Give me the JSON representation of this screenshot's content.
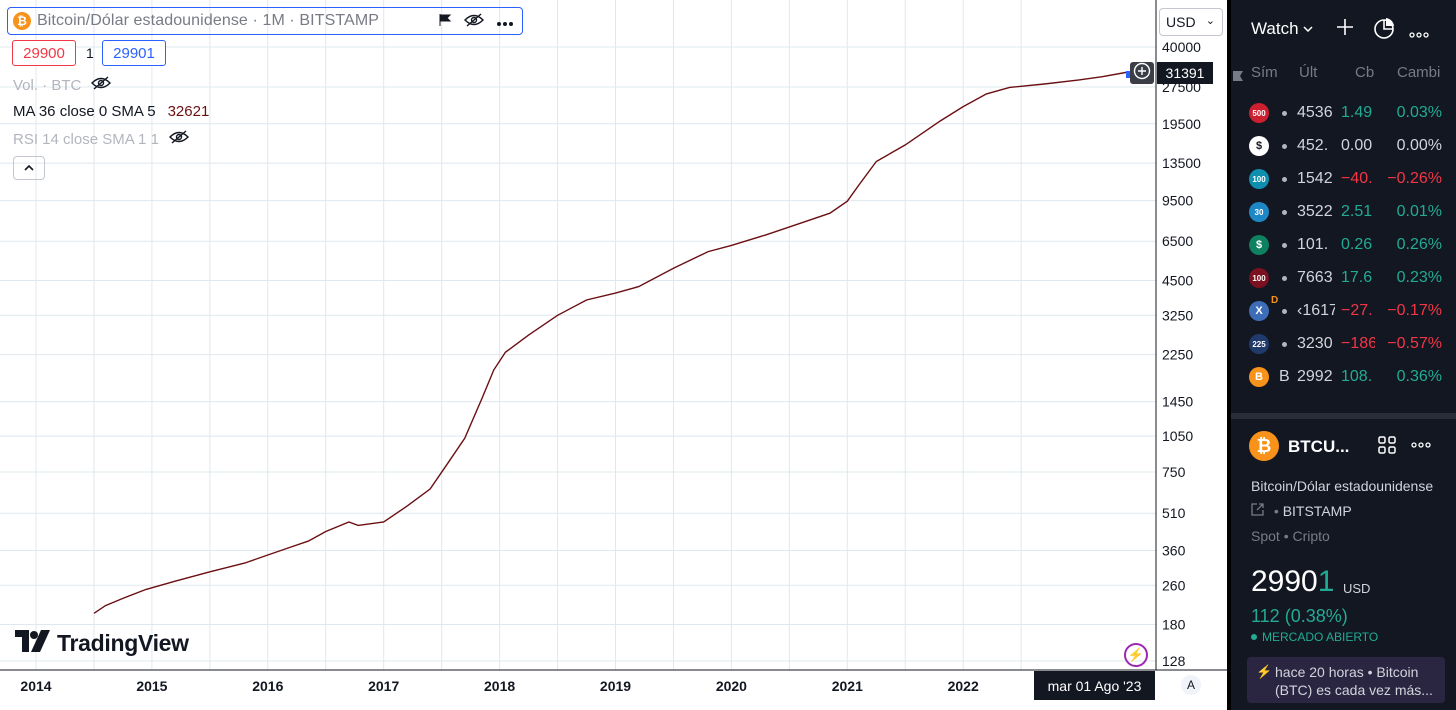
{
  "chart": {
    "legend_title": "Bitcoin/Dólar estadounidense · 1M · BITSTAMP",
    "bid": "29900",
    "spread": "1",
    "ask": "29901",
    "indicators": {
      "volume": "Vol. · BTC",
      "ma_label": "MA 36 close 0 SMA 5",
      "ma_value": "32621",
      "rsi": "RSI 14 close SMA 1 1"
    },
    "currency": "USD",
    "last_price": "31391",
    "crosshair_time": "mar 01 Ago '23",
    "auto_label": "A",
    "logo": "TradingView",
    "price_ticks": [
      "40000",
      "27500",
      "19500",
      "13500",
      "9500",
      "6500",
      "4500",
      "3250",
      "2250",
      "1450",
      "1050",
      "750",
      "510",
      "360",
      "260",
      "180",
      "128"
    ],
    "time_ticks": [
      "2014",
      "2015",
      "2016",
      "2017",
      "2018",
      "2019",
      "2020",
      "2021",
      "2022"
    ],
    "series_color": "#6b0f12",
    "chart_data": {
      "type": "line",
      "title": "",
      "xlabel": "",
      "ylabel": "",
      "log_scale": true,
      "ylim": [
        128,
        40000
      ],
      "xlim": [
        2014.0,
        2023.9
      ],
      "grid": true,
      "series": [
        {
          "name": "MA 36 close 0 SMA 5",
          "x": [
            2014.5,
            2014.6,
            2014.75,
            2014.95,
            2015.2,
            2015.5,
            2015.8,
            2016.0,
            2016.2,
            2016.35,
            2016.5,
            2016.7,
            2016.78,
            2016.85,
            2017.0,
            2017.2,
            2017.4,
            2017.55,
            2017.7,
            2017.85,
            2017.95,
            2018.05,
            2018.25,
            2018.5,
            2018.75,
            2019.0,
            2019.2,
            2019.5,
            2019.8,
            2020.0,
            2020.3,
            2020.6,
            2020.85,
            2021.0,
            2021.1,
            2021.25,
            2021.5,
            2021.8,
            2022.0,
            2022.2,
            2022.4,
            2022.7,
            2023.0,
            2023.2,
            2023.4,
            2023.6
          ],
          "values": [
            200,
            215,
            230,
            250,
            270,
            295,
            320,
            345,
            372,
            393,
            430,
            470,
            455,
            460,
            470,
            545,
            640,
            810,
            1030,
            1500,
            1950,
            2300,
            2700,
            3250,
            3750,
            4000,
            4250,
            5050,
            5900,
            6250,
            6900,
            7700,
            8450,
            9450,
            11000,
            13700,
            16000,
            20000,
            22900,
            25800,
            27400,
            28300,
            29400,
            30300,
            31500,
            32621
          ]
        }
      ]
    }
  },
  "watchlist": {
    "header_label": "Watch",
    "columns": [
      "Sím",
      "Últ",
      "Cb",
      "Cambi"
    ],
    "rows": [
      {
        "badge": "500",
        "badge_color": "#cc1f2f",
        "sym": "",
        "last": "4536",
        "chg": "1.49",
        "pct": "0.03%",
        "dir": "up"
      },
      {
        "badge": "$",
        "badge_color": "#ffffff",
        "sym": "",
        "last": "452.",
        "chg": "0.00",
        "pct": "0.00%",
        "dir": "flat"
      },
      {
        "badge": "100",
        "badge_color": "#0f8fb0",
        "sym": "",
        "last": "1542",
        "chg": "−40.",
        "pct": "−0.26%",
        "dir": "down"
      },
      {
        "badge": "30",
        "badge_color": "#1e88c6",
        "sym": "",
        "last": "3522",
        "chg": "2.51",
        "pct": "0.01%",
        "dir": "up"
      },
      {
        "badge": "$",
        "badge_color": "#0f8060",
        "sym": "",
        "last": "101.",
        "chg": "0.26",
        "pct": "0.26%",
        "dir": "up"
      },
      {
        "badge": "100",
        "badge_color": "#7a1020",
        "sym": "",
        "last": "7663",
        "chg": "17.6",
        "pct": "0.23%",
        "dir": "up"
      },
      {
        "badge": "X",
        "badge_color": "#3d6db8",
        "sym": "",
        "last": "‹1617",
        "chg": "−27.",
        "pct": "−0.17%",
        "dir": "down",
        "flag": "D"
      },
      {
        "badge": "225",
        "badge_color": "#1f3a6b",
        "sym": "",
        "last": "3230",
        "chg": "−186",
        "pct": "−0.57%",
        "dir": "down"
      },
      {
        "badge": "B",
        "badge_color": "#f7931a",
        "sym": "B",
        "last": "2992",
        "chg": "108.",
        "pct": "0.36%",
        "dir": "up"
      }
    ]
  },
  "detail": {
    "symbol": "BTCU...",
    "description": "Bitcoin/Dólar estadounidense",
    "exchange": "BITSTAMP",
    "type": "Spot • Cripto",
    "price_main": "2990",
    "price_tail": "1",
    "price_currency": "USD",
    "change": "112 (0.38%)",
    "market_status": "MERCADO ABIERTO",
    "news": "hace 20 horas • Bitcoin (BTC) es cada vez más..."
  }
}
